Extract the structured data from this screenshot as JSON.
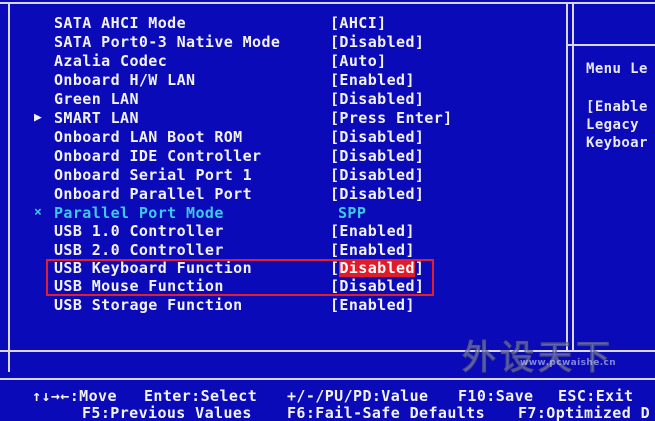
{
  "settings": [
    {
      "label": "SATA AHCI Mode",
      "value": "[AHCI]",
      "marker": ""
    },
    {
      "label": "SATA Port0-3 Native Mode",
      "value": "[Disabled]",
      "marker": ""
    },
    {
      "label": "Azalia Codec",
      "value": "[Auto]",
      "marker": ""
    },
    {
      "label": "Onboard H/W LAN",
      "value": "[Enabled]",
      "marker": ""
    },
    {
      "label": "Green LAN",
      "value": "[Disabled]",
      "marker": ""
    },
    {
      "label": "SMART LAN",
      "value": "[Press Enter]",
      "marker": "▶"
    },
    {
      "label": "Onboard LAN Boot ROM",
      "value": "[Disabled]",
      "marker": ""
    },
    {
      "label": "Onboard IDE Controller",
      "value": "[Disabled]",
      "marker": ""
    },
    {
      "label": "Onboard Serial Port 1",
      "value": "[Disabled]",
      "marker": ""
    },
    {
      "label": "Onboard Parallel Port",
      "value": "[Disabled]",
      "marker": ""
    },
    {
      "label": "Parallel Port Mode",
      "value": "SPP",
      "marker": "×"
    },
    {
      "label": "USB 1.0 Controller",
      "value": "[Enabled]",
      "marker": ""
    },
    {
      "label": "USB 2.0 Controller",
      "value": "[Enabled]",
      "marker": ""
    },
    {
      "label": "USB Keyboard Function",
      "value_open": "[",
      "value_selected": "Disabled",
      "value_close": "]",
      "marker": ""
    },
    {
      "label": "USB Mouse Function",
      "value": "[Disabled]",
      "marker": ""
    },
    {
      "label": "USB Storage Function",
      "value": "[Enabled]",
      "marker": ""
    }
  ],
  "help": {
    "title": "Menu Le",
    "line1": "[Enable",
    "line2": "Legacy",
    "line3": "Keyboar"
  },
  "footer": {
    "row1": {
      "move": "↑↓→←:Move",
      "select": "Enter:Select",
      "value": "+/-/PU/PD:Value",
      "save": "F10:Save",
      "exit": "ESC:Exit"
    },
    "row2": {
      "previous": "F5:Previous Values",
      "failsafe": "F6:Fail-Safe Defaults",
      "optimized": "F7:Optimized D"
    }
  },
  "watermark": {
    "text": "外设天下",
    "url": "www.pcwaishe.cn"
  },
  "colors": {
    "background": "#0a0ab8",
    "text": "#f2f2f2",
    "disabled_text": "#41c7e8",
    "highlight": "#e01c2a"
  }
}
